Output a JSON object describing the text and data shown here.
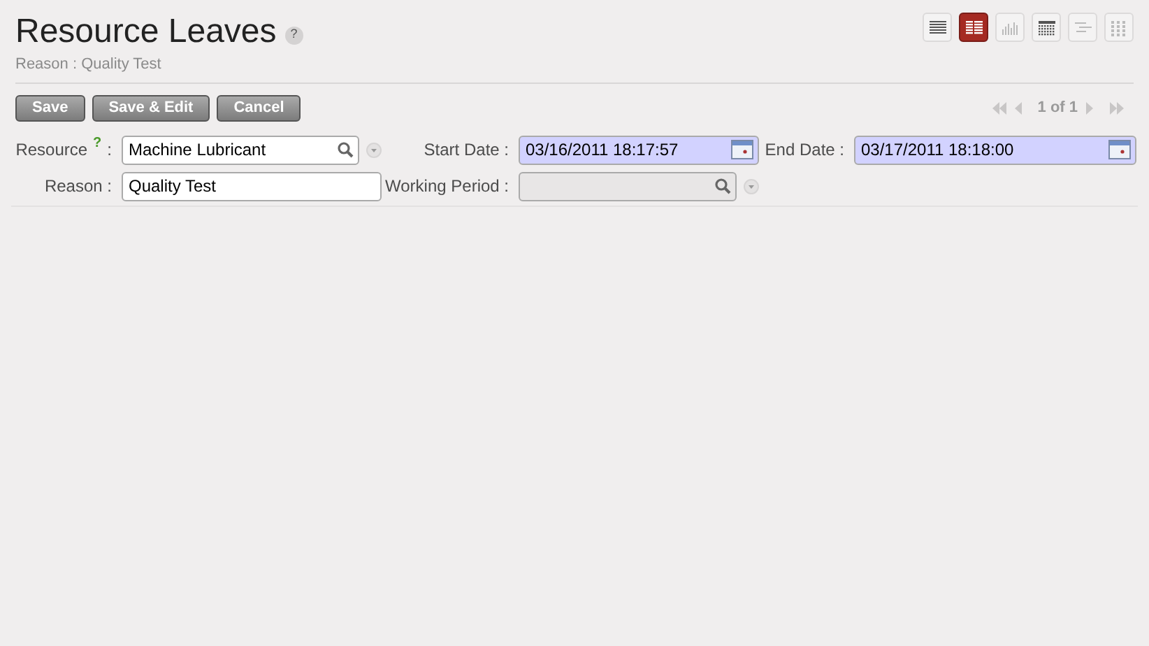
{
  "title": "Resource Leaves",
  "help": "?",
  "breadcrumb": "Reason : Quality Test",
  "views": [
    {
      "kind": "list",
      "selected": false
    },
    {
      "kind": "form",
      "selected": true
    },
    {
      "kind": "graph",
      "selected": false
    },
    {
      "kind": "calendar",
      "selected": false
    },
    {
      "kind": "gantt",
      "selected": false
    },
    {
      "kind": "kanban",
      "selected": false
    }
  ],
  "buttons": [
    "Save",
    "Save & Edit",
    "Cancel"
  ],
  "pager": {
    "text": "1 of 1",
    "disabled": true
  },
  "rows": [
    [
      {
        "kind": "many2one",
        "label": "Resource",
        "help": "?",
        "colon": ":",
        "value": "Machine Lubricant",
        "required": false
      },
      {
        "kind": "date",
        "label": "Start Date :",
        "value": "03/16/2011 18:17:57",
        "required": true
      },
      {
        "kind": "date",
        "label": "End Date :",
        "value": "03/17/2011 18:18:00",
        "required": true
      }
    ],
    [
      {
        "kind": "char",
        "label": "Reason :",
        "value": "Quality Test",
        "required": false
      },
      {
        "kind": "many2one",
        "label": "Working Period :",
        "required": false,
        "disabled": true
      }
    ]
  ]
}
